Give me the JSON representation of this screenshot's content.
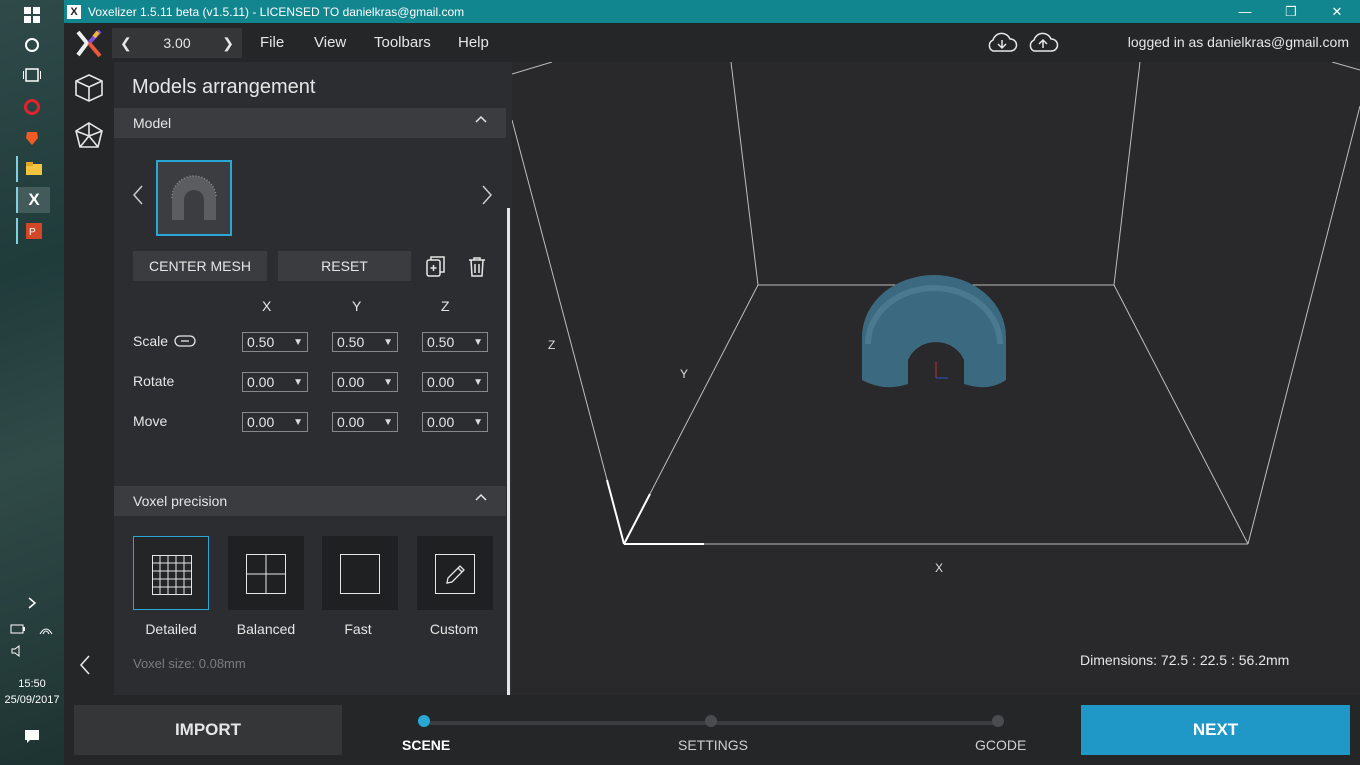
{
  "window": {
    "title": "Voxelizer 1.5.11 beta (v1.5.11) - LICENSED TO danielkras@gmail.com",
    "minimize": "—",
    "restore": "❐",
    "close": "✕"
  },
  "taskbar": {
    "time": "15:50",
    "date": "25/09/2017"
  },
  "menubar": {
    "zoom_value": "3.00",
    "menus": [
      "File",
      "View",
      "Toolbars",
      "Help"
    ],
    "login_text": "logged in as danielkras@gmail.com"
  },
  "panel": {
    "title": "Models arrangement",
    "model_section": "Model",
    "center_mesh": "CENTER MESH",
    "reset": "RESET",
    "columns": [
      "X",
      "Y",
      "Z"
    ],
    "rows": [
      {
        "label": "Scale",
        "values": [
          "0.50",
          "0.50",
          "0.50"
        ]
      },
      {
        "label": "Rotate",
        "values": [
          "0.00",
          "0.00",
          "0.00"
        ]
      },
      {
        "label": "Move",
        "values": [
          "0.00",
          "0.00",
          "0.00"
        ]
      }
    ],
    "voxel_section": "Voxel precision",
    "precision": [
      {
        "label": "Detailed",
        "icon": "grid-fine-icon"
      },
      {
        "label": "Balanced",
        "icon": "grid-quad-icon"
      },
      {
        "label": "Fast",
        "icon": "square-icon"
      },
      {
        "label": "Custom",
        "icon": "pencil-icon"
      }
    ],
    "voxel_size": "Voxel size: 0.08mm"
  },
  "viewport": {
    "axis_x": "X",
    "axis_y": "Y",
    "axis_z": "Z",
    "dimensions": "Dimensions: 72.5 : 22.5 : 56.2mm",
    "model_color": "#3b6a80"
  },
  "bottom": {
    "import": "IMPORT",
    "next": "NEXT",
    "steps": [
      "SCENE",
      "SETTINGS",
      "GCODE"
    ]
  },
  "colors": {
    "accent": "#29a8d6",
    "titlebar": "#12868f"
  }
}
